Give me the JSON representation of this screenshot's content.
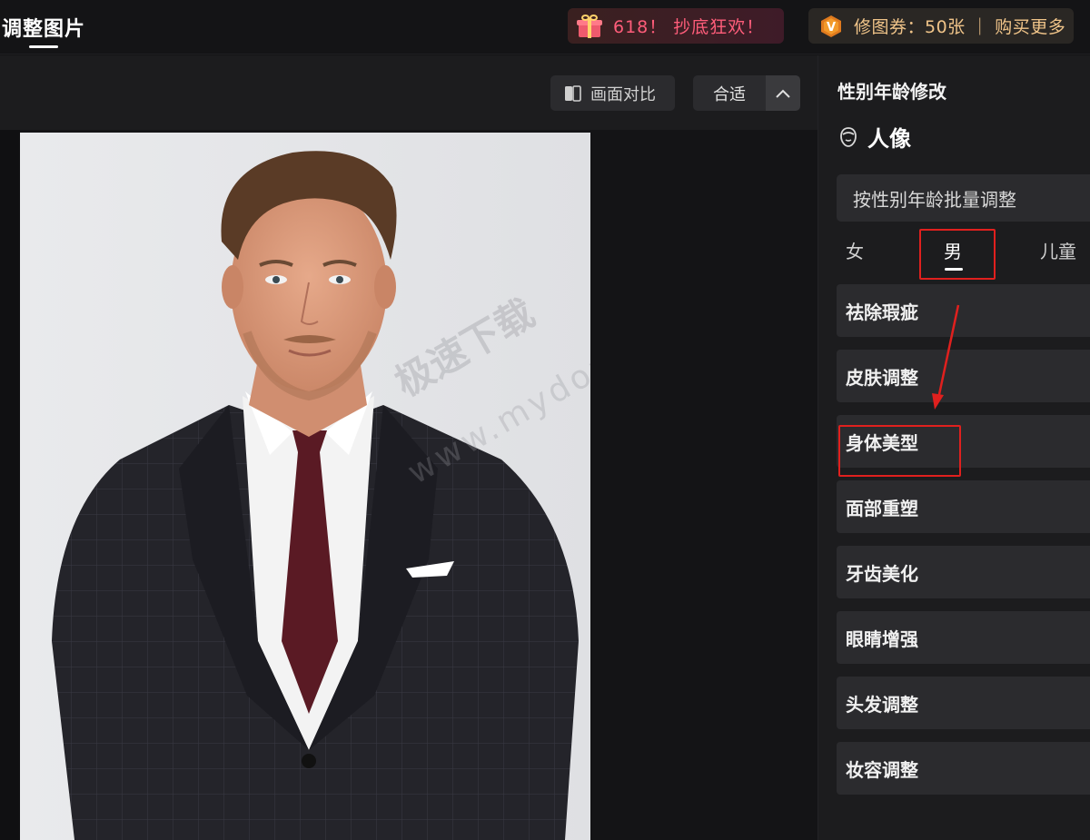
{
  "header": {
    "title": "调整图片",
    "promo_text": "618！ 抄底狂欢！",
    "coupon_text": "修图券：50张 ｜ 购买更多"
  },
  "toolbar": {
    "compare_label": "画面对比",
    "fit_label": "合适"
  },
  "watermark": {
    "text": "极速下载",
    "url": "www.mydown"
  },
  "panel": {
    "title": "性别年龄修改",
    "section": "人像",
    "batch_label": "按性别年龄批量调整",
    "tabs": [
      "女",
      "男",
      "儿童"
    ],
    "selected_tab": "男",
    "items": [
      "祛除瑕疵",
      "皮肤调整",
      "身体美型",
      "面部重塑",
      "牙齿美化",
      "眼睛增强",
      "头发调整",
      "妆容调整"
    ]
  },
  "colors": {
    "highlight": "#e0201e",
    "promo": "#ff5d7a",
    "coupon": "#f0c489"
  }
}
